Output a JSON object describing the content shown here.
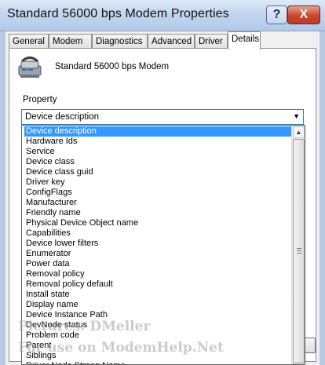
{
  "window": {
    "title": "Standard 56000 bps Modem Properties",
    "help_label": "?",
    "close_label": "X"
  },
  "tabs": [
    "General",
    "Modem",
    "Diagnostics",
    "Advanced",
    "Driver",
    "Details"
  ],
  "active_tab": "Details",
  "device": {
    "name": "Standard 56000 bps Modem",
    "icon": "modem-icon"
  },
  "property": {
    "label": "Property",
    "selected": "Device description",
    "options": [
      "Device description",
      "Hardware Ids",
      "Service",
      "Device class",
      "Device class guid",
      "Driver key",
      "ConfigFlags",
      "Manufacturer",
      "Friendly name",
      "Physical Device Object name",
      "Capabilities",
      "Device lower filters",
      "Enumerator",
      "Power data",
      "Removal policy",
      "Removal policy default",
      "Install state",
      "Display name",
      "Device Instance Path",
      "DevNode status",
      "Problem code",
      "Parent",
      "Siblings",
      "Driver Node Strong Name"
    ]
  },
  "watermark": {
    "line1": "Pictures: DMeller",
    "line2": "For use on ModemHelp.Net"
  },
  "colors": {
    "selection": "#3399ff",
    "close_button": "#c9452f",
    "titlebar": "#c2d6ee"
  }
}
